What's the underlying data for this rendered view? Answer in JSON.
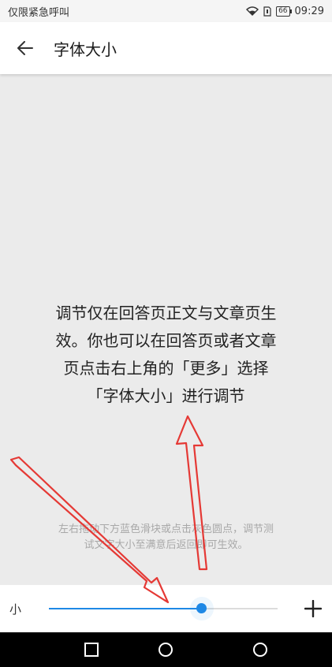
{
  "status_bar": {
    "carrier_text": "仅限紧急呼叫",
    "battery": "66",
    "time": "09:29"
  },
  "app_bar": {
    "title": "字体大小",
    "back_icon": "arrow-left-icon"
  },
  "preview": {
    "line1": "调节仅在回答页正文与文章页生",
    "line2": "效。你也可以在回答页或者文章",
    "line3": "页点击右上角的「更多」选择",
    "line4": "「字体大小」进行调节"
  },
  "hint": {
    "line1": "左右拖动下方蓝色滑块或点击灰色圆点，调节测",
    "line2": "试文字大小至满意后返回即可生效。"
  },
  "slider": {
    "min_label": "小",
    "value_fraction": 0.67,
    "accent_color": "#1e88e5",
    "plus_icon": "plus-icon"
  },
  "nav_bar": {
    "icons": [
      "square-icon",
      "circle-home-icon",
      "circle-icon"
    ]
  },
  "annotation_color": "#e53935"
}
